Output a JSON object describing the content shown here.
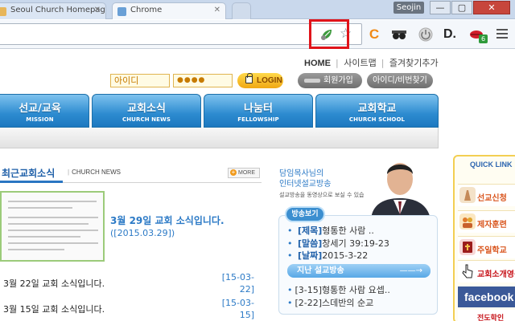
{
  "browser": {
    "tabs": [
      {
        "label": "Seoul Church Homepage"
      },
      {
        "label": "Chrome"
      }
    ],
    "profile_name": "Seojin",
    "window_controls": {
      "minimize": "—",
      "maximize": "▢",
      "close": "✕"
    },
    "extensions": [
      {
        "name": "leaf-extension-icon"
      },
      {
        "name": "bookmark-star-icon",
        "glyph": "☆"
      },
      {
        "name": "c-extension-icon",
        "glyph": "C",
        "color": "#f08a16"
      },
      {
        "name": "glasses-extension-icon"
      },
      {
        "name": "power-extension-icon"
      },
      {
        "name": "d-extension-icon",
        "glyph": "D."
      },
      {
        "name": "lips-extension-icon",
        "badge": "6"
      },
      {
        "name": "chrome-menu-icon"
      }
    ],
    "highlight_color": "#e0141a"
  },
  "header": {
    "toplinks": [
      "HOME",
      "사이트맵",
      "즐겨찾기추가"
    ],
    "login": {
      "id_placeholder": "아이디",
      "pw_value": "●●●●",
      "login_label": "LOGIN",
      "join_label": "회원가입",
      "find_label": "아이디/비번찾기"
    }
  },
  "nav": [
    {
      "ko": "선교/교육",
      "en": "MISSION"
    },
    {
      "ko": "교회소식",
      "en": "CHURCH NEWS"
    },
    {
      "ko": "나눔터",
      "en": "FELLOWSHIP"
    },
    {
      "ko": "교회학교",
      "en": "CHURCH SCHOOL"
    }
  ],
  "news": {
    "tab_label": "최근교회소식",
    "sub_label": "CHURCH NEWS",
    "more_label": "MORE",
    "featured_title": "3월 29일 교회 소식입니다.",
    "featured_date": "([2015.03.29])",
    "rows": [
      {
        "title": "3월 22일 교회 소식입니다.",
        "date": "[15-03-22]"
      },
      {
        "title": "3월 15일 교회 소식입니다.",
        "date": "[15-03-15]"
      }
    ]
  },
  "sermon": {
    "title_line1": "담임목사님의",
    "title_line2": "인터넷설교방송",
    "subtitle": "설교방송을 동영상으로 보실 수 있습니다.",
    "badge": "방송보기",
    "current": [
      {
        "key": "[제목]",
        "value": "형통한 사람 .."
      },
      {
        "key": "[말씀]",
        "value": "창세기 39:19-23"
      },
      {
        "key": "[날짜]",
        "value": "2015-3-22"
      }
    ],
    "past_label": "지난 설교방송",
    "past_arrow": "——→",
    "past_items": [
      "[3-15]형통한 사람 요셉..",
      "[2-22]스데반의 순교"
    ]
  },
  "quick": {
    "title": "QUICK LINK",
    "items": [
      {
        "label": "선교신청",
        "color": "#d9541c"
      },
      {
        "label": "제자훈련",
        "color": "#d9541c"
      },
      {
        "label": "주일학교",
        "color": "#d9541c"
      },
      {
        "label": "교회소개영상",
        "color": "#c7131a"
      }
    ],
    "facebook": "facebook",
    "bottom_label": "전도학인"
  }
}
